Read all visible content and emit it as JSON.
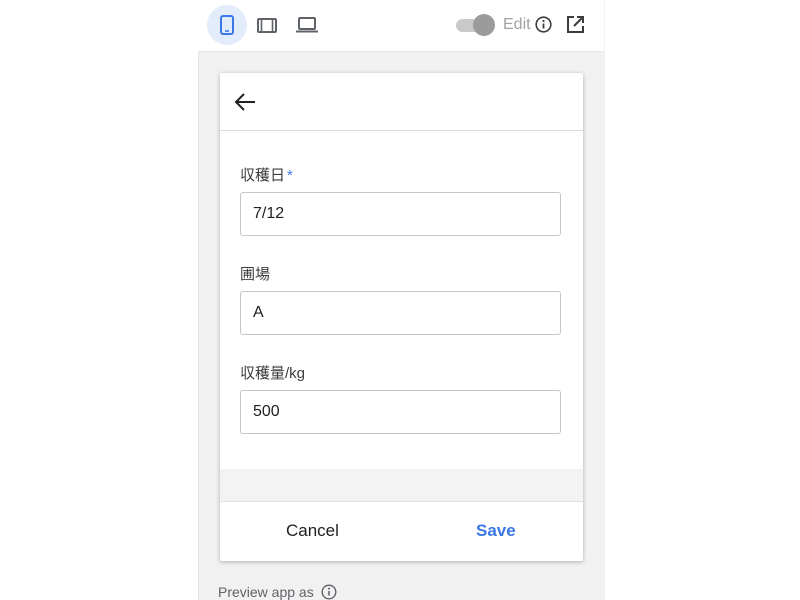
{
  "toolbar": {
    "devices": [
      {
        "name": "phone",
        "active": true
      },
      {
        "name": "tablet",
        "active": false
      },
      {
        "name": "desktop",
        "active": false
      }
    ],
    "edit_label": "Edit",
    "accent": "#3b78e7"
  },
  "form": {
    "fields": [
      {
        "label": "収穫日",
        "required_marker": "*",
        "value": "7/12"
      },
      {
        "label": "圃場",
        "value": "A"
      },
      {
        "label": "収穫量/kg",
        "value": "500"
      }
    ],
    "cancel_label": "Cancel",
    "save_label": "Save"
  },
  "footer": {
    "preview_label": "Preview app as"
  }
}
